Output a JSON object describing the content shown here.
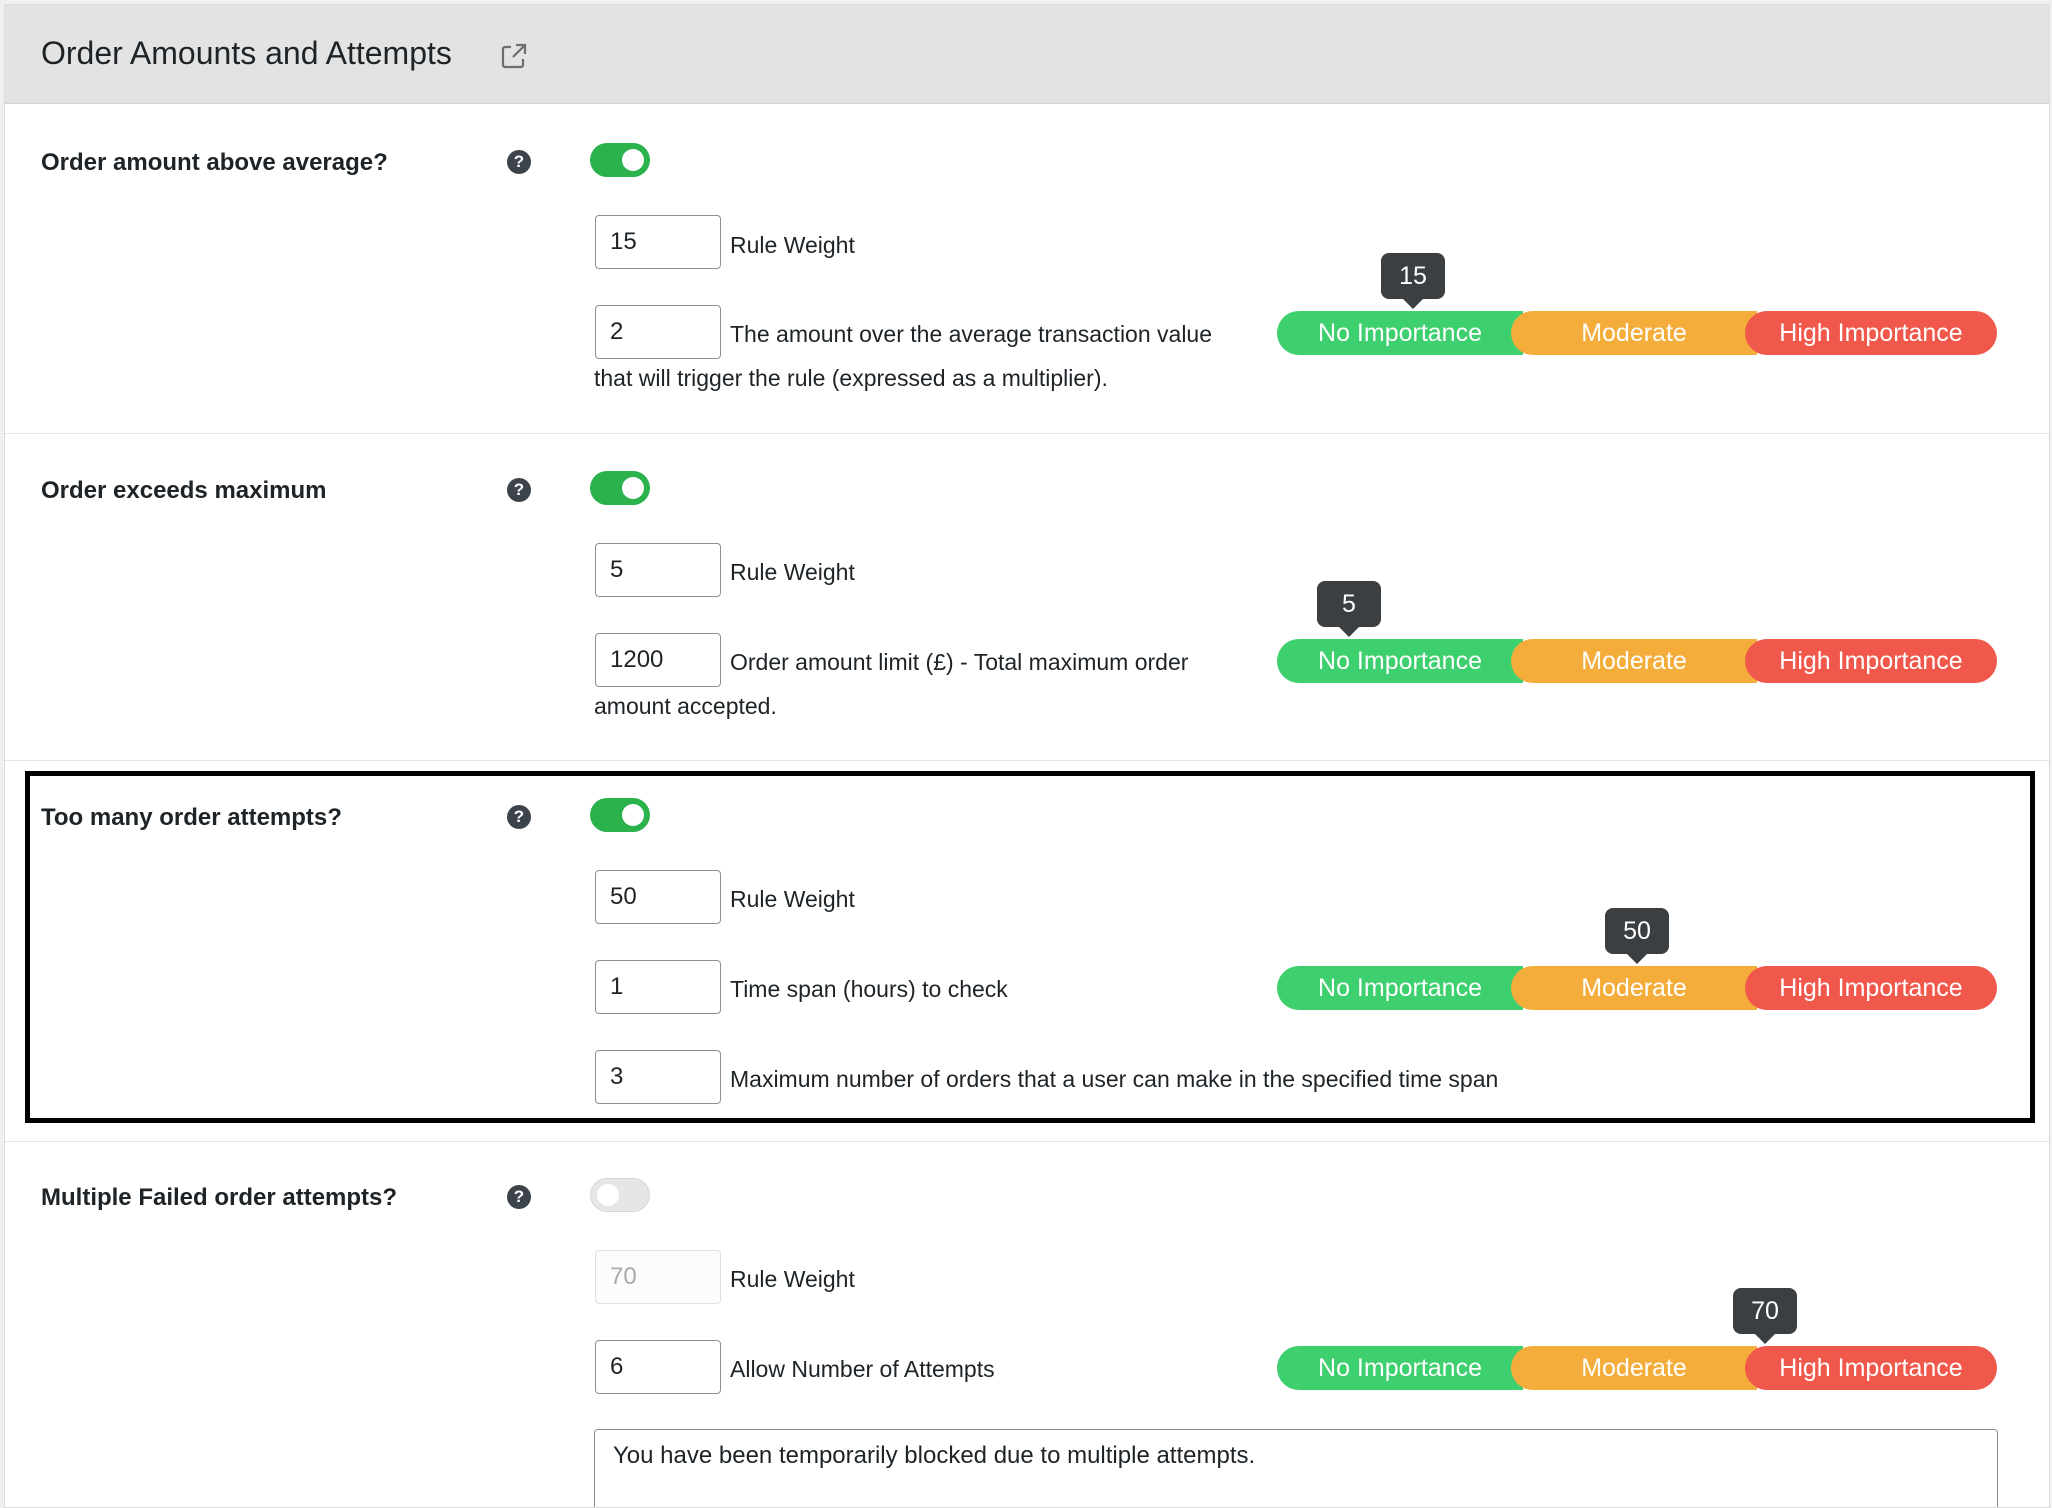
{
  "header": {
    "title": "Order Amounts and Attempts",
    "icon": "external-link-icon"
  },
  "importance_scale": {
    "segments": [
      "No Importance",
      "Moderate",
      "High Importance"
    ],
    "colors": {
      "none": "#3ecf6e",
      "moderate": "#f4ad3a",
      "high": "#f1584c"
    },
    "range": [
      0,
      100
    ]
  },
  "colors": {
    "toggle_on": "#2bb24c",
    "toggle_off": "#e6e6e6",
    "bubble": "#3c3f41"
  },
  "rules": [
    {
      "label": "Order amount above average?",
      "help": "?",
      "enabled": true,
      "weight": {
        "value": "15",
        "label": "Rule Weight"
      },
      "slider_value": 15,
      "fields": [
        {
          "value": "2",
          "label_line1": "The amount over the average transaction value",
          "label_line2": "that will trigger the rule (expressed as a multiplier)."
        }
      ]
    },
    {
      "label": "Order exceeds maximum",
      "help": "?",
      "enabled": true,
      "weight": {
        "value": "5",
        "label": "Rule Weight"
      },
      "slider_value": 5,
      "fields": [
        {
          "value": "1200",
          "label_line1": "Order amount limit (£) - Total maximum order",
          "label_line2": "amount accepted."
        }
      ]
    },
    {
      "label": "Too many order attempts?",
      "help": "?",
      "enabled": true,
      "highlighted": true,
      "weight": {
        "value": "50",
        "label": "Rule Weight"
      },
      "slider_value": 50,
      "fields": [
        {
          "value": "1",
          "label": "Time span (hours) to check"
        },
        {
          "value": "3",
          "label": "Maximum number of orders that a user can make in the specified time span"
        }
      ]
    },
    {
      "label": "Multiple Failed order attempts?",
      "help": "?",
      "enabled": false,
      "weight": {
        "value": "70",
        "label": "Rule Weight"
      },
      "slider_value": 70,
      "fields": [
        {
          "value": "6",
          "label": "Allow Number of Attempts"
        }
      ],
      "message": "You have been temporarily blocked due to multiple attempts."
    }
  ]
}
